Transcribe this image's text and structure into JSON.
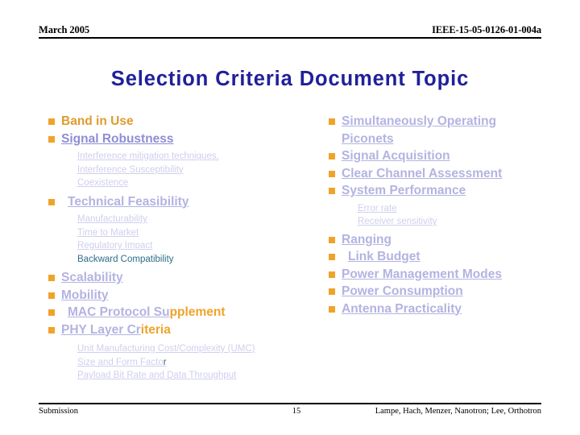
{
  "header": {
    "left": "March 2005",
    "right": "IEEE-15-05-0126-01-004a"
  },
  "title": "Selection Criteria Document Topic",
  "left_column": {
    "items": [
      {
        "label": "Band in Use",
        "style": "orange-plain"
      },
      {
        "label": "Signal Robustness",
        "style": "blue-underline"
      },
      {
        "label": "Technical Feasibility",
        "style": "blue-pale-underline"
      },
      {
        "label": "Scalability",
        "style": "blue-pale-underline"
      },
      {
        "label": "Mobility",
        "style": "blue-pale-underline"
      },
      {
        "label": "MAC Protocol Supplement",
        "style": "split",
        "part_blue": "MAC Protocol Su",
        "part_orange": "pplement"
      },
      {
        "label": "PHY Layer Criteria",
        "style": "split",
        "part_blue": "PHY Layer Cr",
        "part_orange": "iteria"
      }
    ],
    "signal_robustness_subitems": [
      "Interference mitigation techniques.",
      "Interference Susceptibility",
      "Coexistence"
    ],
    "technical_feasibility_subitems": [
      "Manufacturability",
      "Time to Market",
      "Regulatory Impact",
      "Backward Compatibility"
    ],
    "phy_layer_subitems": [
      "Unit Manufacturing Cost/Complexity (UMC)",
      "Size and Form Factor",
      "Payload Bit Rate and Data Throughput"
    ],
    "size_form_factor_head": "Size and Form Facto",
    "size_form_factor_tail": "r"
  },
  "right_column": {
    "items": [
      {
        "label": "Simultaneously Operating",
        "label2": "Piconets"
      },
      {
        "label": "Signal Acquisition"
      },
      {
        "label": "Clear Channel Assessment"
      },
      {
        "label": "System Performance"
      },
      {
        "label": "Ranging"
      },
      {
        "label": "Link Budget"
      },
      {
        "label": "Power Management Modes"
      },
      {
        "label": "Power Consumption"
      },
      {
        "label": "Antenna Practicality"
      }
    ],
    "system_performance_subitems": [
      "Error rate",
      "Receiver sensitivity"
    ]
  },
  "footer": {
    "left": "Submission",
    "page": "15",
    "right": "Lampe, Hach, Menzer, Nanotron; Lee, Orthotron"
  },
  "colors": {
    "title": "#20209a",
    "bullet_square": "#f0a32a",
    "orange_text": "#e09b2d",
    "blue_mid": "#8e8ed6",
    "blue_pale": "#b3b3e2",
    "sub_text": "#cfcfee",
    "sub_dark": "#2c6f86"
  }
}
